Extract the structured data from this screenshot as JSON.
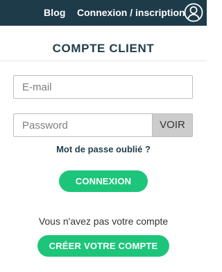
{
  "header": {
    "nav": {
      "blog_label": "Blog",
      "login_label": "Connexion / inscription",
      "user_icon": "user-icon"
    }
  },
  "main": {
    "title": "COMPTE CLIENT",
    "email_placeholder": "E-mail",
    "password_placeholder": "Password",
    "show_password_label": "VOIR",
    "forgot_password_label": "Mot de passe oublié ?",
    "login_button_label": "CONNEXION",
    "no_account_text": "Vous n'avez pas votre compte",
    "create_account_button_label": "CRÉER VOTRE COMPTE"
  },
  "colors": {
    "header_bg": "#1e3b49",
    "accent_green": "#1dc57a",
    "title_text": "#1f3d4a",
    "show_button_bg": "#cccccc"
  }
}
